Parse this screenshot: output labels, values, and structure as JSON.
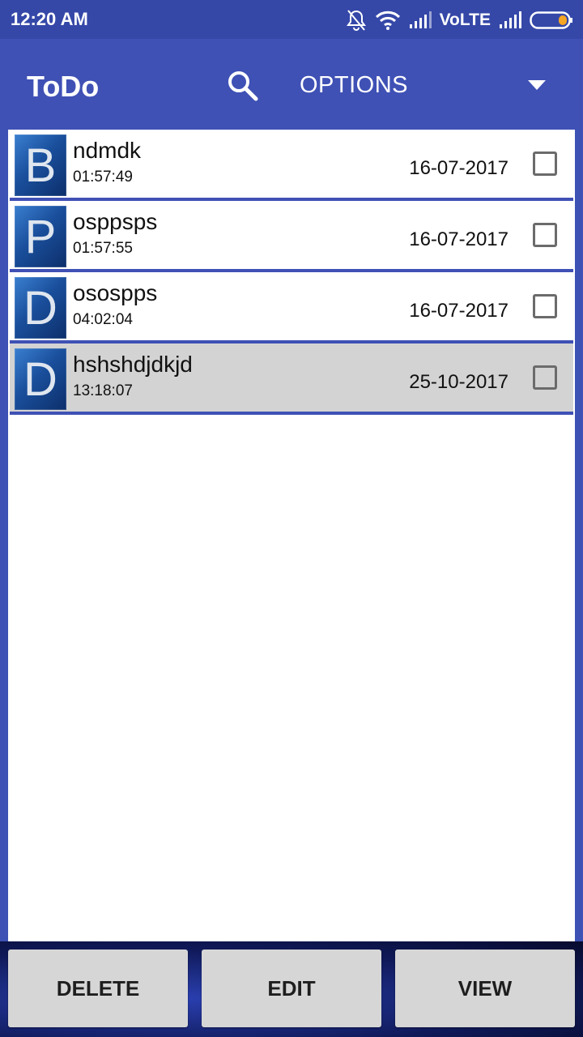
{
  "status_bar": {
    "time": "12:20 AM",
    "network_label": "VoLTE",
    "icons": [
      "notifications-off-icon",
      "wifi-icon",
      "signal-icon",
      "signal-icon",
      "battery-icon"
    ]
  },
  "app_bar": {
    "title": "ToDo",
    "search_icon": "search-icon",
    "options_label": "OPTIONS",
    "dropdown_icon": "dropdown-arrow-icon"
  },
  "todos": [
    {
      "letter": "B",
      "title": "ndmdk",
      "time": "01:57:49",
      "date": "16-07-2017",
      "checked": false,
      "selected": false
    },
    {
      "letter": "P",
      "title": "osppsps",
      "time": "01:57:55",
      "date": "16-07-2017",
      "checked": false,
      "selected": false
    },
    {
      "letter": "D",
      "title": "osospps",
      "time": "04:02:04",
      "date": "16-07-2017",
      "checked": false,
      "selected": false
    },
    {
      "letter": "D",
      "title": "hshshdjdkjd",
      "time": "13:18:07",
      "date": "25-10-2017",
      "checked": false,
      "selected": true
    }
  ],
  "bottom_bar": {
    "delete_label": "DELETE",
    "edit_label": "EDIT",
    "view_label": "VIEW"
  },
  "colors": {
    "primary": "#3f51b5",
    "status_bar": "#3548a8",
    "selected_row": "#d3d3d3",
    "battery_accent": "#f5a623"
  }
}
